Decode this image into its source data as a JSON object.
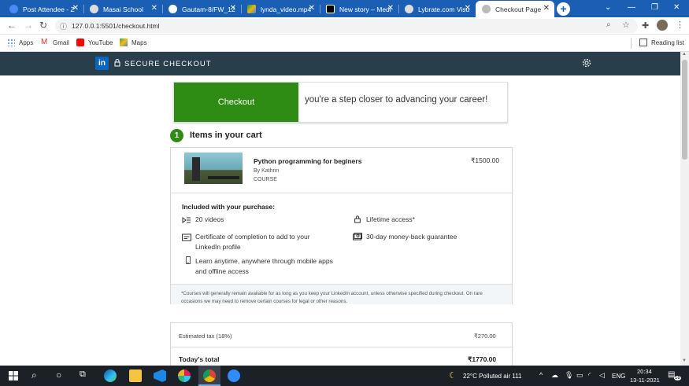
{
  "browser": {
    "tabs": [
      {
        "label": "Post Attendee - Z",
        "icon_color": "#4a8af4"
      },
      {
        "label": "Masai School",
        "icon_color": "#dddddd"
      },
      {
        "label": "Gautam-8/FW_12",
        "icon_color": "#ffffff"
      },
      {
        "label": "lynda_video.mp4",
        "icon_color": "#f4b400"
      },
      {
        "label": "New story – Medi",
        "icon_color": "#000000"
      },
      {
        "label": "Lybrate.com Visu",
        "icon_color": "#dddddd"
      },
      {
        "label": "Checkout Page",
        "icon_color": "#dddddd"
      }
    ],
    "url": "127.0.0.1:5501/checkout.html",
    "bookmarks": [
      "Apps",
      "Gmail",
      "YouTube",
      "Maps"
    ],
    "reading_list": "Reading list"
  },
  "header": {
    "logo": "in",
    "secure_label": "SECURE CHECKOUT"
  },
  "hero": {
    "button_label": "Checkout",
    "tagline": "you're a step closer to advancing your career!"
  },
  "cart": {
    "step_number": "1",
    "title": "Items in your cart",
    "item": {
      "title": "Python programming for beginers",
      "author": "By Kathrin",
      "type": "COURSE",
      "price": "₹1500.00"
    },
    "included_heading": "Included with your purchase:",
    "features": [
      {
        "icon": "video-list-icon",
        "text": "20 videos"
      },
      {
        "icon": "lock-icon",
        "text": "Lifetime access*"
      },
      {
        "icon": "certificate-icon",
        "text": "Certificate of completion to add to your LinkedIn profile"
      },
      {
        "icon": "money-icon",
        "text": "30-day money-back guarantee"
      },
      {
        "icon": "mobile-icon",
        "text": "Learn anytime, anywhere through mobile apps and offline access"
      }
    ],
    "note": "*Courses will generally remain available for as long as you keep your LinkedIn account, unless otherwise specified during checkout. On rare occasions we may need to remove certain courses for legal or other reasons."
  },
  "totals": {
    "tax_label": "Estimated tax (18%)",
    "tax_value": "₹270.00",
    "total_label": "Today's total",
    "total_value": "₹1770.00"
  },
  "taskbar": {
    "weather": "22°C  Polluted air 111",
    "language": "ENG",
    "time": "20:34",
    "date": "13-11-2021",
    "notifications": "16"
  }
}
